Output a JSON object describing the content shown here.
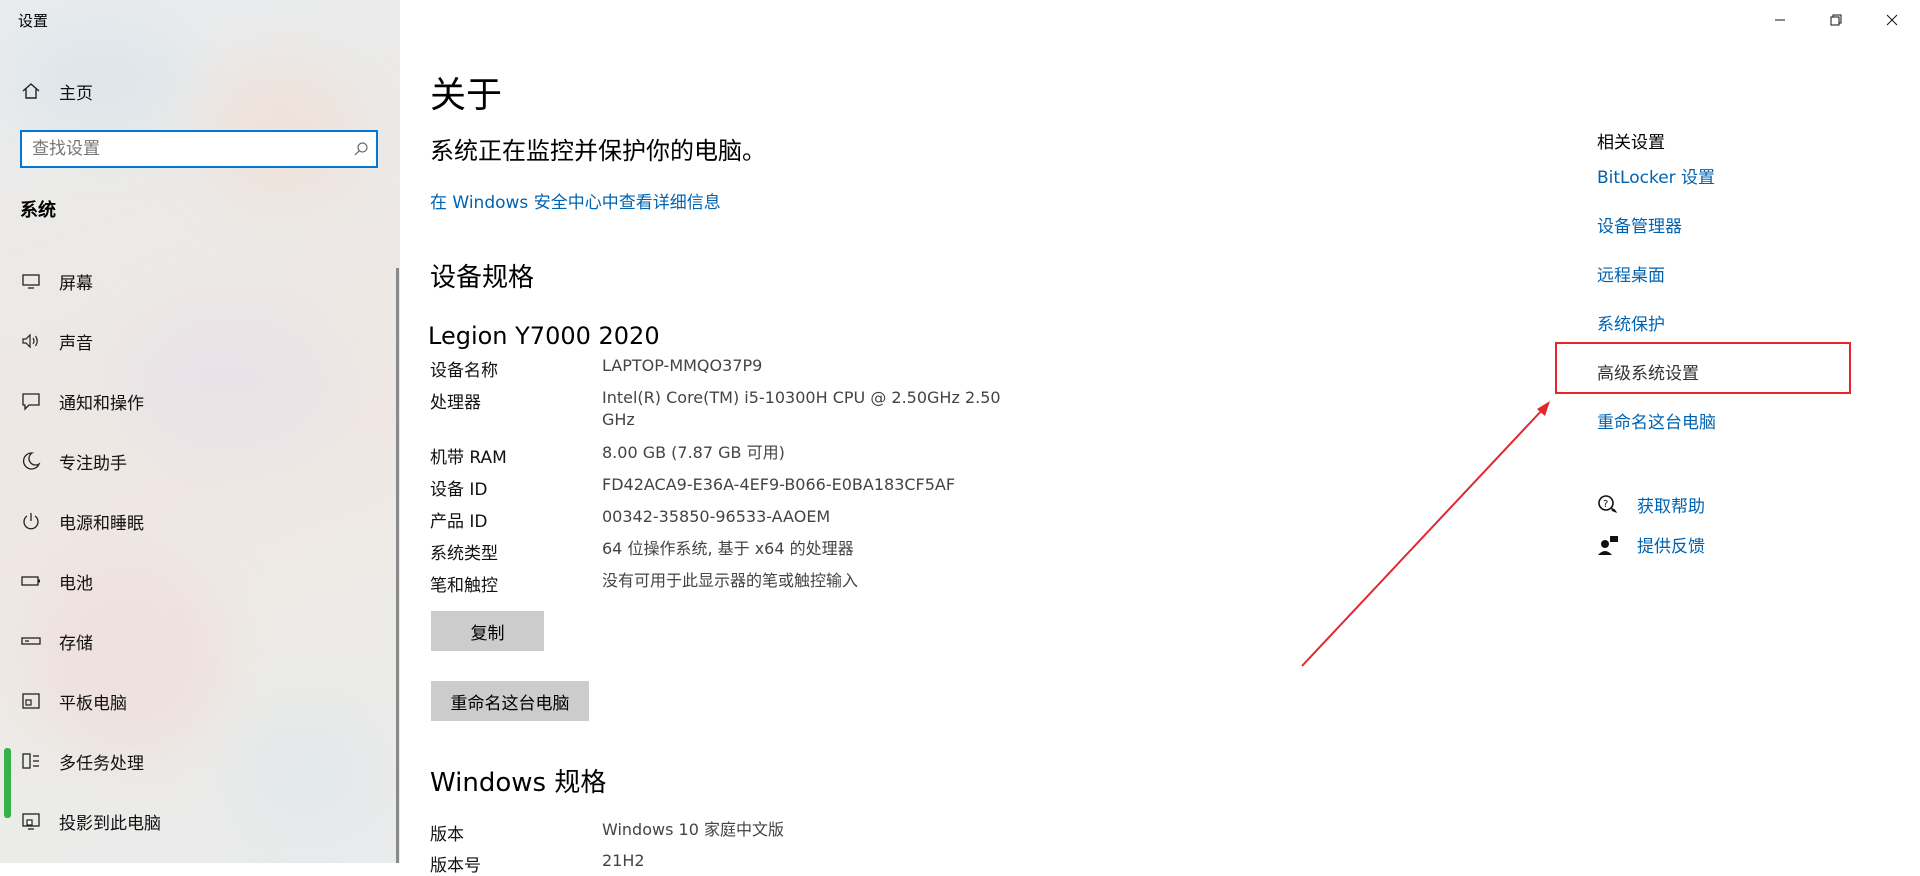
{
  "window": {
    "title": "设置"
  },
  "sidebar": {
    "home_label": "主页",
    "search_placeholder": "查找设置",
    "section": "系统",
    "items": [
      {
        "label": "屏幕",
        "icon": "monitor-icon"
      },
      {
        "label": "声音",
        "icon": "speaker-icon"
      },
      {
        "label": "通知和操作",
        "icon": "notification-icon"
      },
      {
        "label": "专注助手",
        "icon": "moon-icon"
      },
      {
        "label": "电源和睡眠",
        "icon": "power-icon"
      },
      {
        "label": "电池",
        "icon": "battery-icon"
      },
      {
        "label": "存储",
        "icon": "storage-icon"
      },
      {
        "label": "平板电脑",
        "icon": "tablet-icon"
      },
      {
        "label": "多任务处理",
        "icon": "multitask-icon"
      },
      {
        "label": "投影到此电脑",
        "icon": "project-icon"
      }
    ]
  },
  "main": {
    "title": "关于",
    "protect_text": "系统正在监控并保护你的电脑。",
    "security_link": "在 Windows 安全中心中查看详细信息",
    "device_specs_heading": "设备规格",
    "device_model": "Legion Y7000 2020",
    "specs": [
      {
        "label": "设备名称",
        "value": "LAPTOP-MMQO37P9"
      },
      {
        "label": "处理器",
        "value": "Intel(R) Core(TM) i5-10300H CPU @ 2.50GHz   2.50 GHz"
      },
      {
        "label": "机带 RAM",
        "value": "8.00 GB (7.87 GB 可用)"
      },
      {
        "label": "设备 ID",
        "value": "FD42ACA9-E36A-4EF9-B066-E0BA183CF5AF"
      },
      {
        "label": "产品 ID",
        "value": "00342-35850-96533-AAOEM"
      },
      {
        "label": "系统类型",
        "value": "64 位操作系统, 基于 x64 的处理器"
      },
      {
        "label": "笔和触控",
        "value": "没有可用于此显示器的笔或触控输入"
      }
    ],
    "copy_button": "复制",
    "rename_button": "重命名这台电脑",
    "windows_specs_heading": "Windows 规格",
    "win_specs": [
      {
        "label": "版本",
        "value": "Windows 10 家庭中文版"
      },
      {
        "label": "版本号",
        "value": "21H2"
      }
    ]
  },
  "related": {
    "title": "相关设置",
    "links": [
      "BitLocker 设置",
      "设备管理器",
      "远程桌面",
      "系统保护",
      "高级系统设置",
      "重命名这台电脑"
    ],
    "help": [
      {
        "label": "获取帮助",
        "icon": "help-chat-icon"
      },
      {
        "label": "提供反馈",
        "icon": "feedback-icon"
      }
    ]
  },
  "colors": {
    "accent": "#0063b1",
    "search_border": "#0078d7",
    "annotation": "#e0282e",
    "button": "#cccccc"
  }
}
